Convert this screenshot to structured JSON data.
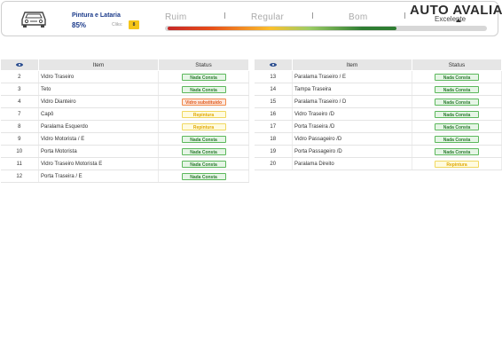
{
  "header": {
    "category_title": "Pintura e Lataria",
    "percent": "85%",
    "cliks_label": "Cliks:",
    "cliks_value": "8",
    "scale": [
      "Ruim",
      "Regular",
      "Bom",
      "Excelente"
    ],
    "scale_level_percent": 71,
    "logo": "AUTO AVALIAR",
    "icon": "car-front-icon"
  },
  "table_headers": {
    "eye_icon": "eye-icon",
    "item": "Item",
    "status": "Status"
  },
  "left_rows": [
    {
      "num": "2",
      "item": "Vidro Traseiro",
      "status": "Nada Consta",
      "kind": "ok"
    },
    {
      "num": "3",
      "item": "Teto",
      "status": "Nada Consta",
      "kind": "ok"
    },
    {
      "num": "4",
      "item": "Vidro Dianteiro",
      "status": "Vidro substituido",
      "kind": "bad"
    },
    {
      "num": "7",
      "item": "Capô",
      "status": "Repintura",
      "kind": "warn"
    },
    {
      "num": "8",
      "item": "Paralama Esquerdo",
      "status": "Repintura",
      "kind": "warn"
    },
    {
      "num": "9",
      "item": "Vidro Motorista / E",
      "status": "Nada Consta",
      "kind": "ok"
    },
    {
      "num": "10",
      "item": "Porta Motorista",
      "status": "Nada Consta",
      "kind": "ok"
    },
    {
      "num": "11",
      "item": "Vidro Traseiro Motorista E",
      "status": "Nada Consta",
      "kind": "ok"
    },
    {
      "num": "12",
      "item": "Porta Traseira / E",
      "status": "Nada Consta",
      "kind": "ok"
    }
  ],
  "right_rows": [
    {
      "num": "13",
      "item": "Paralama Traseiro / E",
      "status": "Nada Consta",
      "kind": "ok"
    },
    {
      "num": "14",
      "item": "Tampa Traseira",
      "status": "Nada Consta",
      "kind": "ok"
    },
    {
      "num": "15",
      "item": "Paralama Traseiro / D",
      "status": "Nada Consta",
      "kind": "ok"
    },
    {
      "num": "16",
      "item": "Vidro Traseiro /D",
      "status": "Nada Consta",
      "kind": "ok"
    },
    {
      "num": "17",
      "item": "Porta Traseira /D",
      "status": "Nada Consta",
      "kind": "ok"
    },
    {
      "num": "18",
      "item": "Vidro Passageiro /D",
      "status": "Nada Consta",
      "kind": "ok"
    },
    {
      "num": "19",
      "item": "Porta Passageiro /D",
      "status": "Nada Consta",
      "kind": "ok"
    },
    {
      "num": "20",
      "item": "Paralama Direito",
      "status": "Repintura",
      "kind": "warn"
    }
  ],
  "colors": {
    "ok": "#2e7d32",
    "warn": "#e0a800",
    "bad": "#e05a1b",
    "title": "#1a3a8a"
  }
}
